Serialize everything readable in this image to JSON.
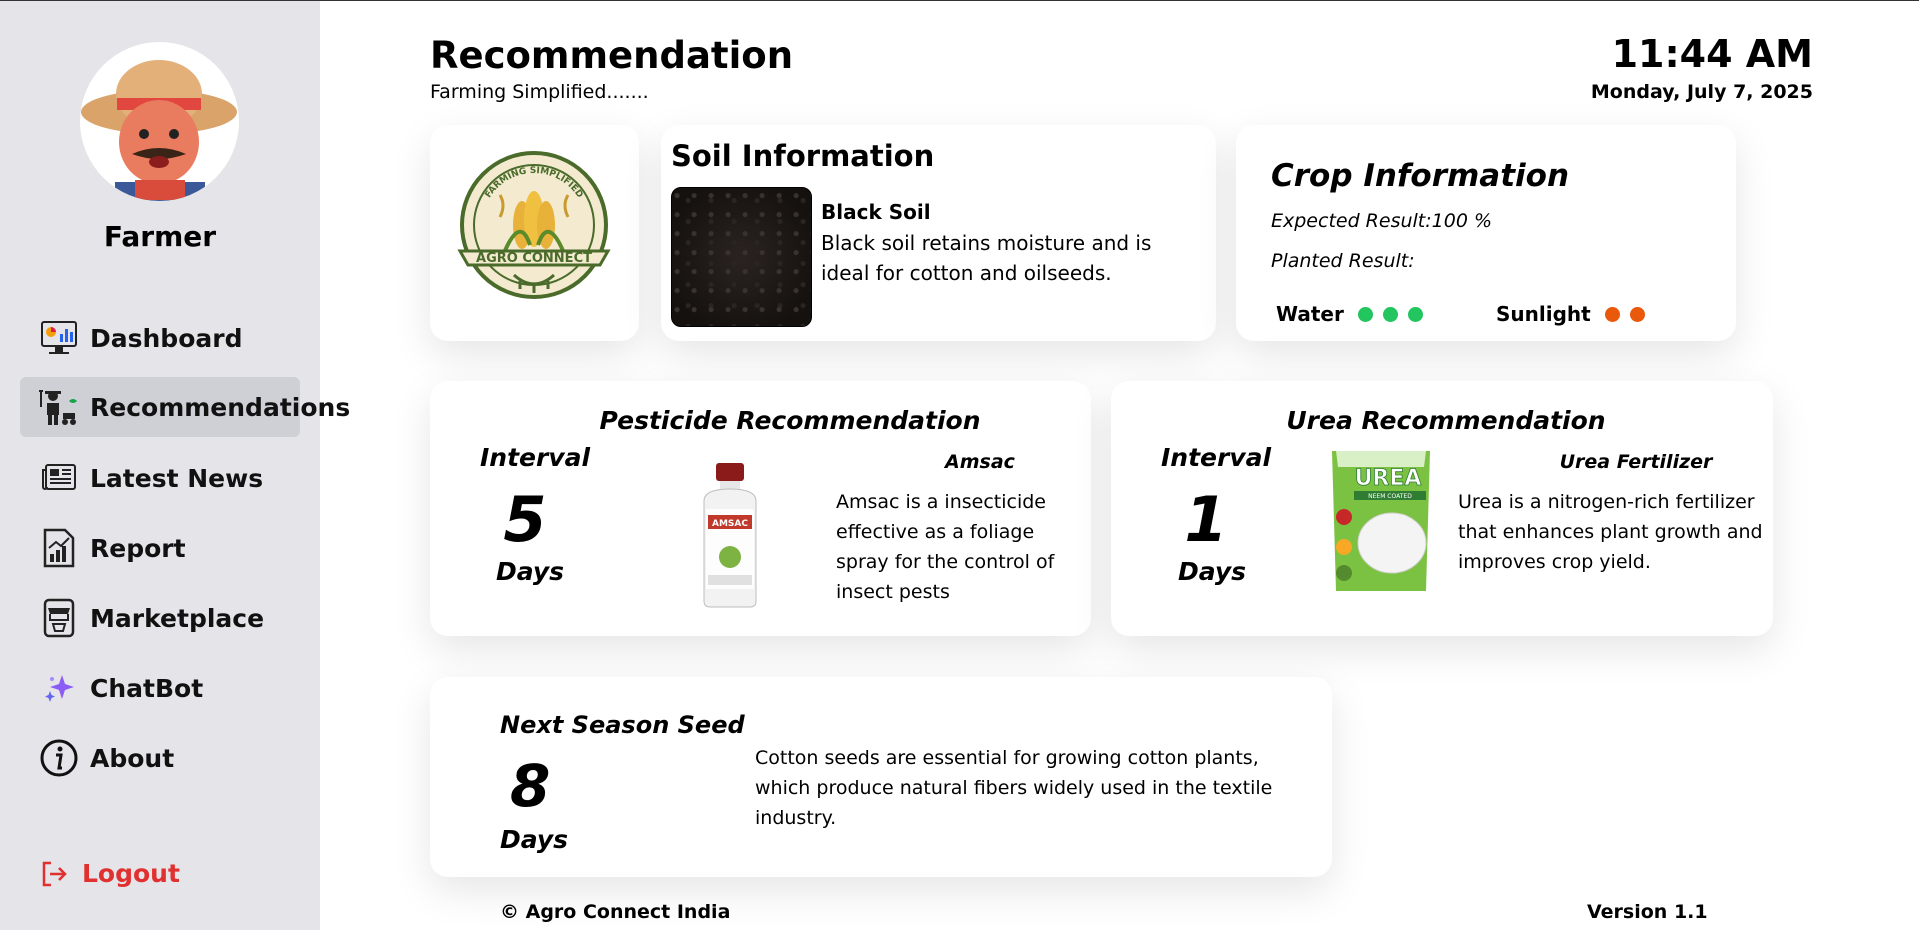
{
  "sidebar": {
    "user_name": "Farmer",
    "items": [
      {
        "label": "Dashboard",
        "icon": "dashboard-icon"
      },
      {
        "label": "Recommendations",
        "icon": "farmer-icon"
      },
      {
        "label": "Latest News",
        "icon": "newspaper-icon"
      },
      {
        "label": "Report",
        "icon": "report-chart-icon"
      },
      {
        "label": "Marketplace",
        "icon": "store-icon"
      },
      {
        "label": "ChatBot",
        "icon": "sparkle-icon"
      },
      {
        "label": "About",
        "icon": "info-icon"
      }
    ],
    "logout_label": "Logout"
  },
  "header": {
    "title": "Recommendation",
    "subtitle": "Farming Simplified.......",
    "time": "11:44 AM",
    "date": "Monday, July 7, 2025"
  },
  "logo": {
    "top_text": "FARMING SIMPLIFIED",
    "banner_text": "AGRO CONNECT"
  },
  "soil": {
    "title": "Soil Information",
    "name": "Black Soil",
    "description": "Black soil retains moisture and is ideal for cotton and oilseeds."
  },
  "crop": {
    "title": "Crop Information",
    "expected": "Expected Result:100 %",
    "planted": "Planted Result:",
    "water_label": "Water",
    "water_level": 3,
    "sunlight_label": "Sunlight",
    "sunlight_level": 2,
    "colors": {
      "water": "#22c55e",
      "sunlight": "#ea580c"
    }
  },
  "pesticide": {
    "title": "Pesticide Recommendation",
    "interval_label": "Interval",
    "interval_value": "5",
    "interval_unit": "Days",
    "product_name": "Amsac",
    "bottle_label": "AMSAC",
    "description": "Amsac is a insecticide effective as a foliage spray for the control of insect pests"
  },
  "urea": {
    "title": "Urea Recommendation",
    "interval_label": "Interval",
    "interval_value": "1",
    "interval_unit": "Days",
    "product_name": "Urea Fertilizer",
    "bag_label": "UREA",
    "bag_sublabel": "NEEM COATED",
    "description": "Urea is a nitrogen-rich fertilizer that enhances plant growth and improves crop yield."
  },
  "seed": {
    "title": "Next Season Seed",
    "value": "8",
    "unit": "Days",
    "description": "Cotton seeds are essential for growing cotton plants, which produce natural fibers widely used in the textile industry."
  },
  "footer": {
    "copyright": "© Agro Connect India",
    "version": "Version 1.1"
  }
}
